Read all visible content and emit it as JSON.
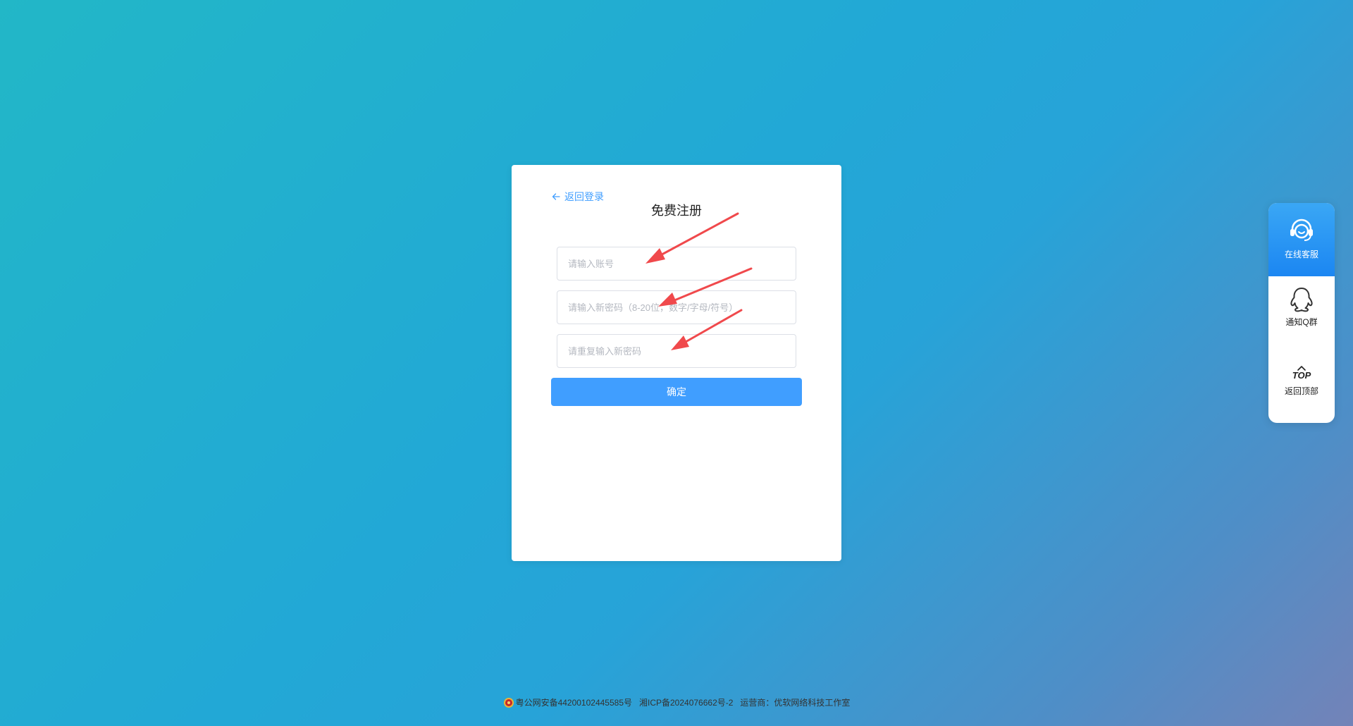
{
  "register": {
    "back_label": "返回登录",
    "title": "免费注册",
    "account_placeholder": "请输入账号",
    "password_placeholder": "请输入新密码（8-20位，数字/字母/符号）",
    "confirm_placeholder": "请重复输入新密码",
    "submit_label": "确定"
  },
  "side_panel": {
    "service_label": "在线客服",
    "service_icon": "headset-icon",
    "qgroup_label": "通知Q群",
    "qgroup_icon": "qq-icon",
    "top_text": "TOP",
    "top_label": "返回顶部",
    "top_icon": "chevron-up-icon"
  },
  "footer": {
    "police_record": "粤公网安备44200102445585号",
    "icp_record": "湘ICP备2024076662号-2",
    "operator": "运营商：优软网络科技工作室"
  },
  "colors": {
    "accent": "#409eff",
    "annotation_arrow": "#f0494c",
    "background_start": "#22b7c7",
    "background_end": "#7383b8"
  }
}
